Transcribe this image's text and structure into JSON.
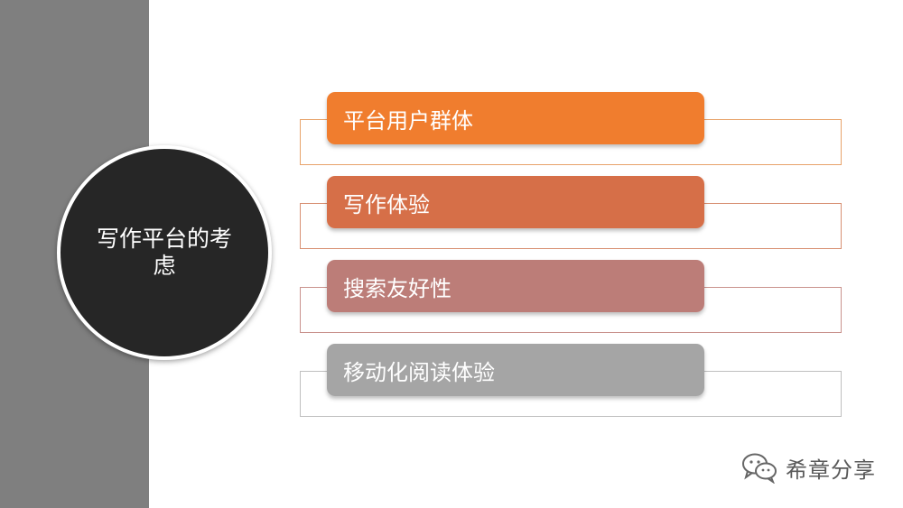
{
  "center": {
    "title": "写作平台的考虑"
  },
  "items": [
    {
      "label": "平台用户群体",
      "color": "#f07d2e",
      "frame_color": "#e8a36b"
    },
    {
      "label": "写作体验",
      "color": "#d66f48",
      "frame_color": "#d89073"
    },
    {
      "label": "搜索友好性",
      "color": "#bc7d78",
      "frame_color": "#c9928d"
    },
    {
      "label": "移动化阅读体验",
      "color": "#a5a5a5",
      "frame_color": "#bfbfbf"
    }
  ],
  "watermark": {
    "text": "希章分享",
    "icon": "wechat-icon"
  }
}
